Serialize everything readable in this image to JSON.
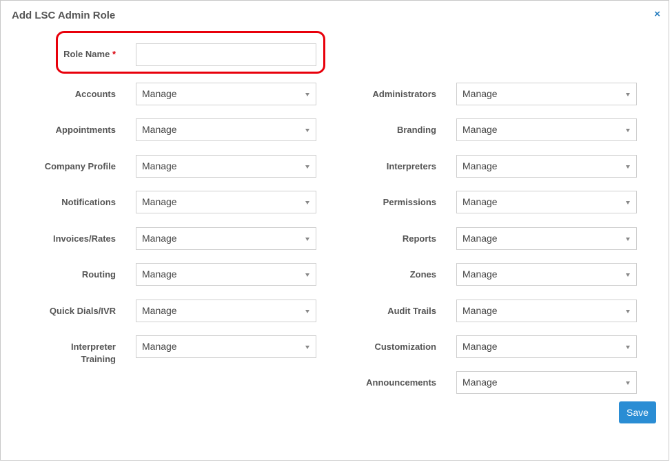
{
  "dialog": {
    "title": "Add LSC Admin Role",
    "close_label": "×"
  },
  "role_name": {
    "label": "Role Name",
    "required_marker": "*",
    "value": "",
    "placeholder": ""
  },
  "left_fields": [
    {
      "label": "Accounts",
      "value": "Manage"
    },
    {
      "label": "Appointments",
      "value": "Manage"
    },
    {
      "label": "Company Profile",
      "value": "Manage"
    },
    {
      "label": "Notifications",
      "value": "Manage"
    },
    {
      "label": "Invoices/Rates",
      "value": "Manage"
    },
    {
      "label": "Routing",
      "value": "Manage"
    },
    {
      "label": "Quick Dials/IVR",
      "value": "Manage"
    },
    {
      "label_line1": "Interpreter",
      "label_line2": "Training",
      "value": "Manage"
    }
  ],
  "right_fields": [
    {
      "label": "Administrators",
      "value": "Manage"
    },
    {
      "label": "Branding",
      "value": "Manage"
    },
    {
      "label": "Interpreters",
      "value": "Manage"
    },
    {
      "label": "Permissions",
      "value": "Manage"
    },
    {
      "label": "Reports",
      "value": "Manage"
    },
    {
      "label": "Zones",
      "value": "Manage"
    },
    {
      "label": "Audit Trails",
      "value": "Manage"
    },
    {
      "label": "Customization",
      "value": "Manage"
    },
    {
      "label": "Announcements",
      "value": "Manage"
    }
  ],
  "save_label": "Save",
  "colors": {
    "highlight": "#e8000b",
    "primary_button": "#2a8dd4",
    "close_icon": "#2a7fc0"
  }
}
